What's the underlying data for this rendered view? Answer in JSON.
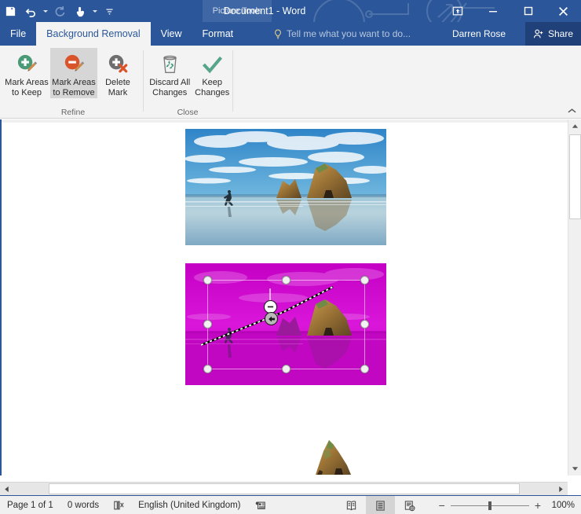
{
  "titlebar": {
    "quick_access": [
      {
        "name": "save-icon",
        "label": "Save",
        "state": "enabled"
      },
      {
        "name": "undo-icon",
        "label": "Undo",
        "state": "enabled",
        "has_dropdown": true
      },
      {
        "name": "redo-icon",
        "label": "Redo",
        "state": "disabled"
      },
      {
        "name": "touch-mouse-mode-icon",
        "label": "Touch/Mouse Mode",
        "state": "enabled",
        "has_dropdown": true
      },
      {
        "name": "customize-qat-icon",
        "label": "Customize Quick Access Toolbar",
        "state": "enabled"
      }
    ],
    "contextual_label": "Picture Tools",
    "document_title": "Document1 - Word",
    "window_controls": [
      {
        "name": "ribbon-display-options-icon",
        "label": "Ribbon Display Options"
      },
      {
        "name": "minimize-icon",
        "label": "Minimize"
      },
      {
        "name": "maximize-icon",
        "label": "Restore Down"
      },
      {
        "name": "close-icon",
        "label": "Close"
      }
    ]
  },
  "tabs": [
    {
      "label": "File",
      "active": false
    },
    {
      "label": "Background Removal",
      "active": true
    },
    {
      "label": "View",
      "active": false
    },
    {
      "label": "Format",
      "active": false,
      "contextual": true
    }
  ],
  "tellme": {
    "placeholder": "Tell me what you want to do...",
    "icon": "lightbulb-icon"
  },
  "account": {
    "name": "Darren Rose"
  },
  "share": {
    "label": "Share",
    "icon": "share-person-icon"
  },
  "ribbon": {
    "groups": [
      {
        "label": "Refine",
        "buttons": [
          {
            "name": "mark-areas-to-keep-button",
            "line1": "Mark Areas",
            "line2": "to Keep",
            "icon": "plus-pencil-icon",
            "selected": false
          },
          {
            "name": "mark-areas-to-remove-button",
            "line1": "Mark Areas",
            "line2": "to Remove",
            "icon": "minus-pencil-icon",
            "selected": true
          },
          {
            "name": "delete-mark-button",
            "line1": "Delete",
            "line2": "Mark",
            "icon": "delete-mark-icon",
            "selected": false
          }
        ]
      },
      {
        "label": "Close",
        "buttons": [
          {
            "name": "discard-all-changes-button",
            "line1": "Discard All",
            "line2": "Changes",
            "icon": "recycle-bin-icon",
            "selected": false
          },
          {
            "name": "keep-changes-button",
            "line1": "Keep",
            "line2": "Changes",
            "icon": "checkmark-icon",
            "selected": false
          }
        ]
      }
    ],
    "collapse_icon": "chevron-up-icon"
  },
  "document": {
    "images": [
      {
        "name": "original-beach-photo",
        "alt": "Beach with rock formations, runner and reflections"
      },
      {
        "name": "background-removal-preview",
        "alt": "Same photo with magenta removal overlay and selection handles"
      },
      {
        "name": "result-cutout-image",
        "alt": "Rock formation with background removed"
      }
    ],
    "markers": [
      {
        "name": "remove-mark-minus-marker",
        "glyph": "minus"
      },
      {
        "name": "mark-cursor-marker",
        "glyph": "arrow"
      }
    ]
  },
  "statusbar": {
    "page": "Page 1 of 1",
    "words": "0 words",
    "proofing_icon": "proofing-errors-icon",
    "language": "English (United Kingdom)",
    "macro_icon": "macro-record-icon",
    "views": [
      {
        "name": "read-mode-button",
        "label": "Read Mode",
        "active": false
      },
      {
        "name": "print-layout-button",
        "label": "Print Layout",
        "active": true
      },
      {
        "name": "web-layout-button",
        "label": "Web Layout",
        "active": false
      }
    ],
    "zoom_out": "−",
    "zoom_in": "+",
    "zoom_level": "100%"
  },
  "colors": {
    "brand_blue": "#2b579a",
    "contextual_blue": "#3f67a5",
    "share_blue": "#1f4078",
    "removal_magenta": "#cc00cc",
    "keep_green": "#4a9a78",
    "remove_red": "#d9542b",
    "delete_x_red": "#d9542b",
    "ribbon_bg": "#f3f3f3",
    "selected_btn": "#d6d6d6"
  }
}
